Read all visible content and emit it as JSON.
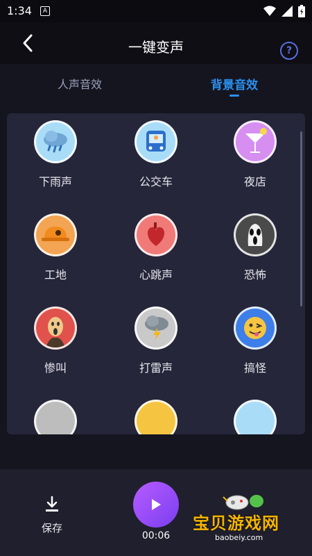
{
  "status": {
    "time": "1:34",
    "notif": "A"
  },
  "header": {
    "title": "一键变声",
    "help": "?"
  },
  "tabs": [
    {
      "label": "人声音效",
      "active": false
    },
    {
      "label": "背景音效",
      "active": true
    }
  ],
  "effects": [
    {
      "label": "下雨声",
      "icon": "rain-cloud-icon"
    },
    {
      "label": "公交车",
      "icon": "bus-icon"
    },
    {
      "label": "夜店",
      "icon": "cocktail-icon"
    },
    {
      "label": "工地",
      "icon": "hard-hat-icon"
    },
    {
      "label": "心跳声",
      "icon": "heart-icon"
    },
    {
      "label": "恐怖",
      "icon": "ghost-mask-icon"
    },
    {
      "label": "惨叫",
      "icon": "scream-icon"
    },
    {
      "label": "打雷声",
      "icon": "thunder-cloud-icon"
    },
    {
      "label": "搞怪",
      "icon": "funny-face-icon"
    }
  ],
  "bottom": {
    "save_label": "保存",
    "time": "00:06"
  },
  "watermark": {
    "text": "宝贝游戏网",
    "url": "baobeiy.com"
  },
  "colors": {
    "accent": "#2b90f0",
    "play": "#9a4df5",
    "panel": "#26263a"
  }
}
